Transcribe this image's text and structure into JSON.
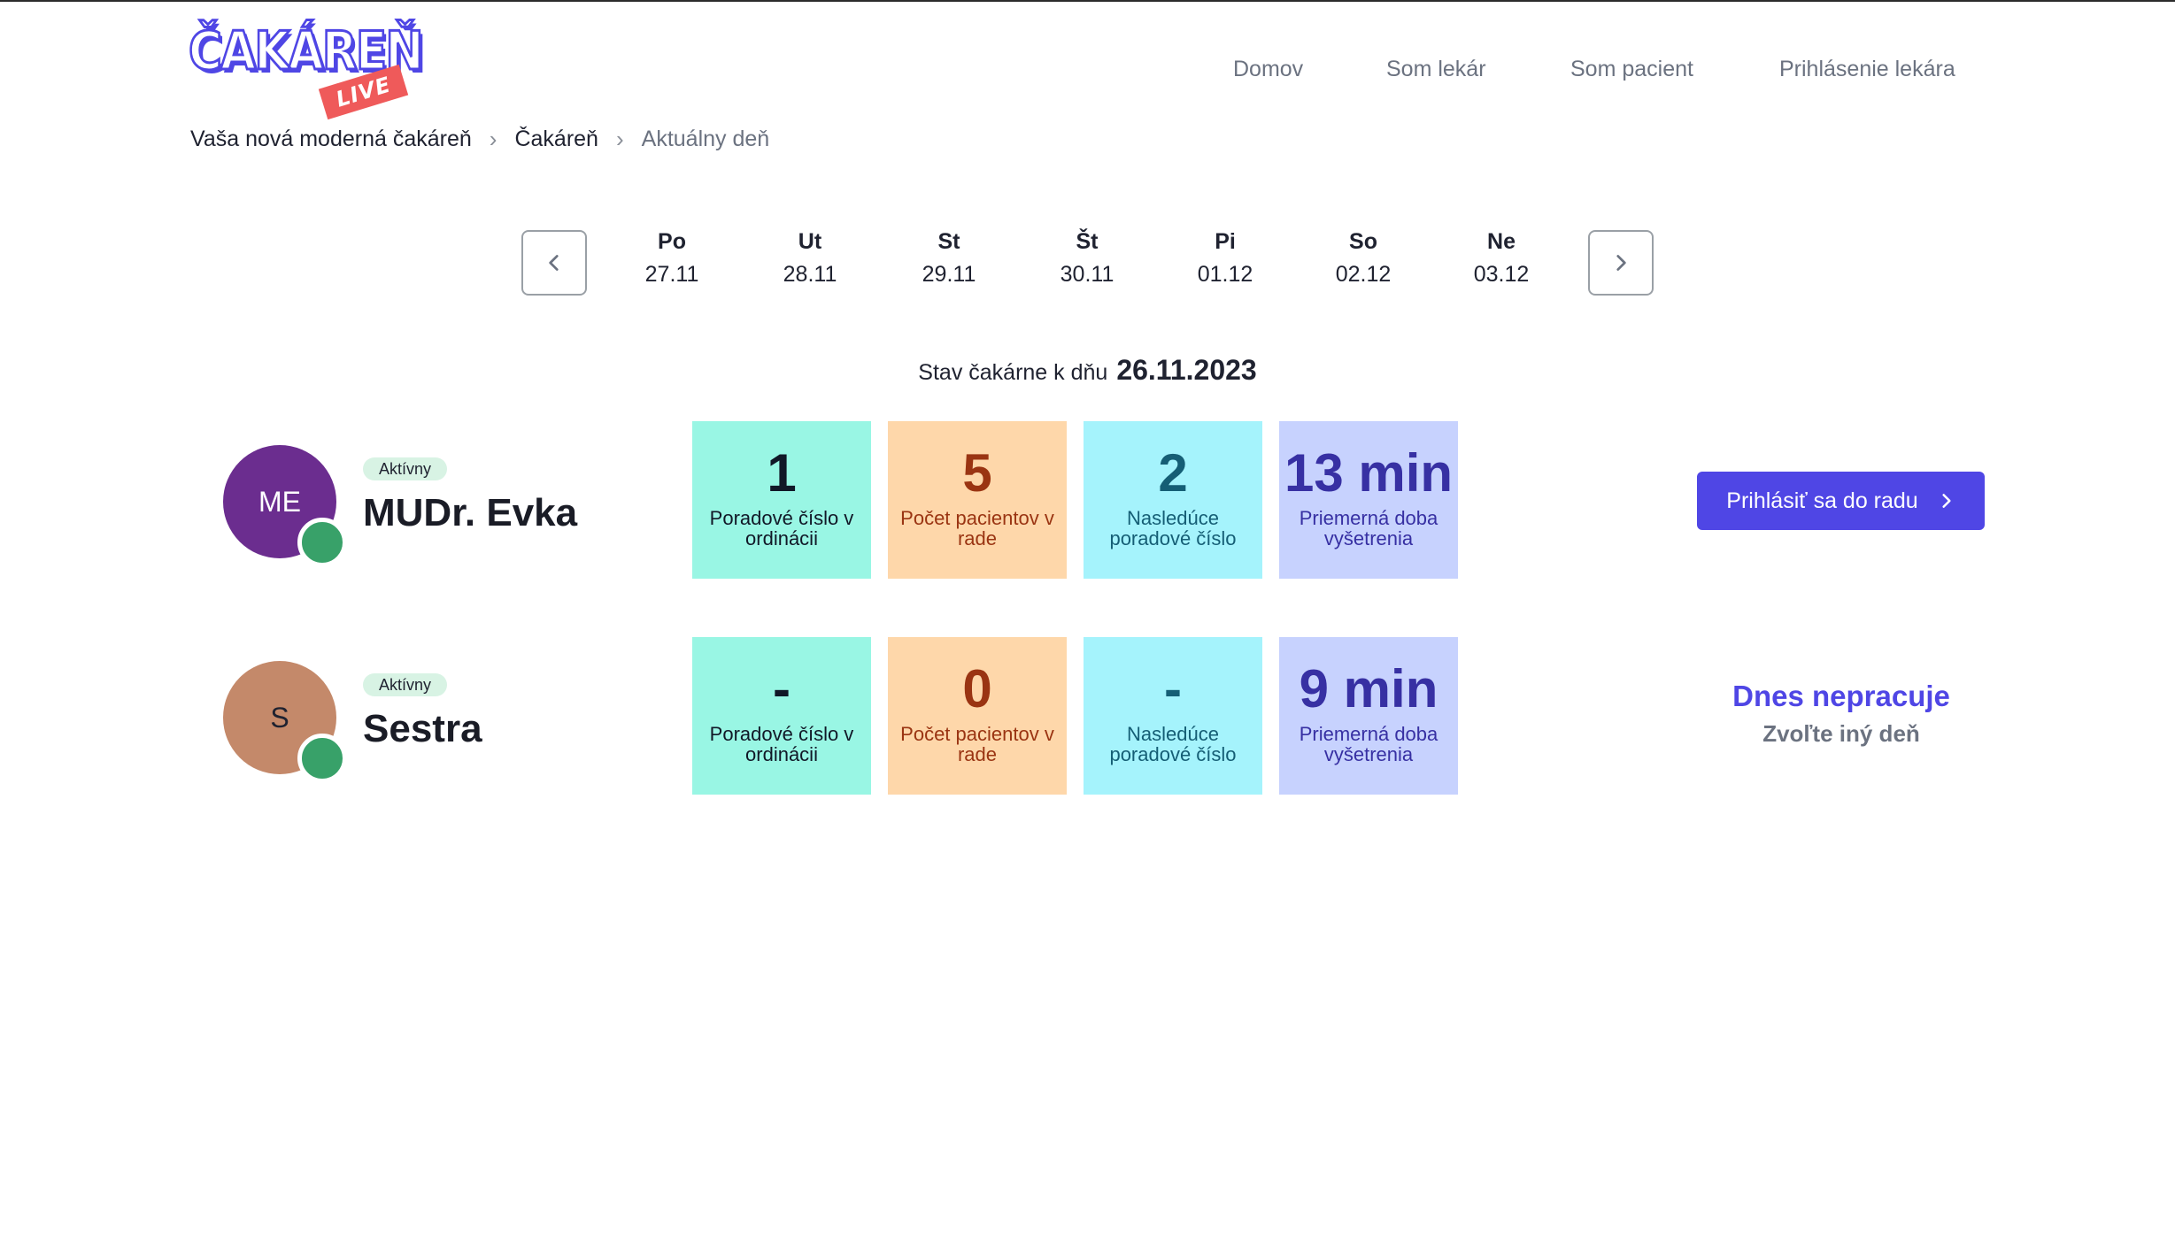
{
  "header": {
    "logo_text": "ČAKÁREŇ",
    "logo_badge": "LIVE",
    "nav": [
      {
        "label": "Domov"
      },
      {
        "label": "Som lekár"
      },
      {
        "label": "Som pacient"
      },
      {
        "label": "Prihlásenie lekára"
      }
    ]
  },
  "breadcrumb": {
    "items": [
      "Vaša nová moderná čakáreň",
      "Čakáreň",
      "Aktuálny deň"
    ],
    "separator": "›"
  },
  "week": {
    "prev_icon": "chevron-left-icon",
    "next_icon": "chevron-right-icon",
    "days": [
      {
        "name": "Po",
        "date": "27.11"
      },
      {
        "name": "Ut",
        "date": "28.11"
      },
      {
        "name": "St",
        "date": "29.11"
      },
      {
        "name": "Št",
        "date": "30.11"
      },
      {
        "name": "Pi",
        "date": "01.12"
      },
      {
        "name": "So",
        "date": "02.12"
      },
      {
        "name": "Ne",
        "date": "03.12"
      }
    ]
  },
  "status": {
    "label": "Stav čakárne k dňu",
    "date": "26.11.2023"
  },
  "doctors": [
    {
      "initials": "ME",
      "avatar_color": "#6b2d8f",
      "status": "Aktívny",
      "name": "MUDr. Evka",
      "stats": [
        {
          "value": "1",
          "label": "Poradové číslo v ordinácii"
        },
        {
          "value": "5",
          "label": "Počet pacientov v rade"
        },
        {
          "value": "2",
          "label": "Nasledúce poradové číslo"
        },
        {
          "value": "13 min",
          "label": "Priemerná doba vyšetrenia"
        }
      ],
      "action": {
        "label": "Prihlásiť sa do radu",
        "icon": "chevron-right-icon"
      }
    },
    {
      "initials": "S",
      "avatar_color": "#c4896a",
      "status": "Aktívny",
      "name": "Sestra",
      "stats": [
        {
          "value": "-",
          "label": "Poradové číslo v ordinácii"
        },
        {
          "value": "0",
          "label": "Počet pacientov v rade"
        },
        {
          "value": "-",
          "label": "Nasledúce poradové číslo"
        },
        {
          "value": "9 min",
          "label": "Priemerná doba vyšetrenia"
        }
      ],
      "unavailable": {
        "title": "Dnes nepracuje",
        "subtitle": "Zvoľte iný deň"
      }
    }
  ],
  "colors": {
    "accent": "#4f46e5",
    "online": "#38a169"
  }
}
